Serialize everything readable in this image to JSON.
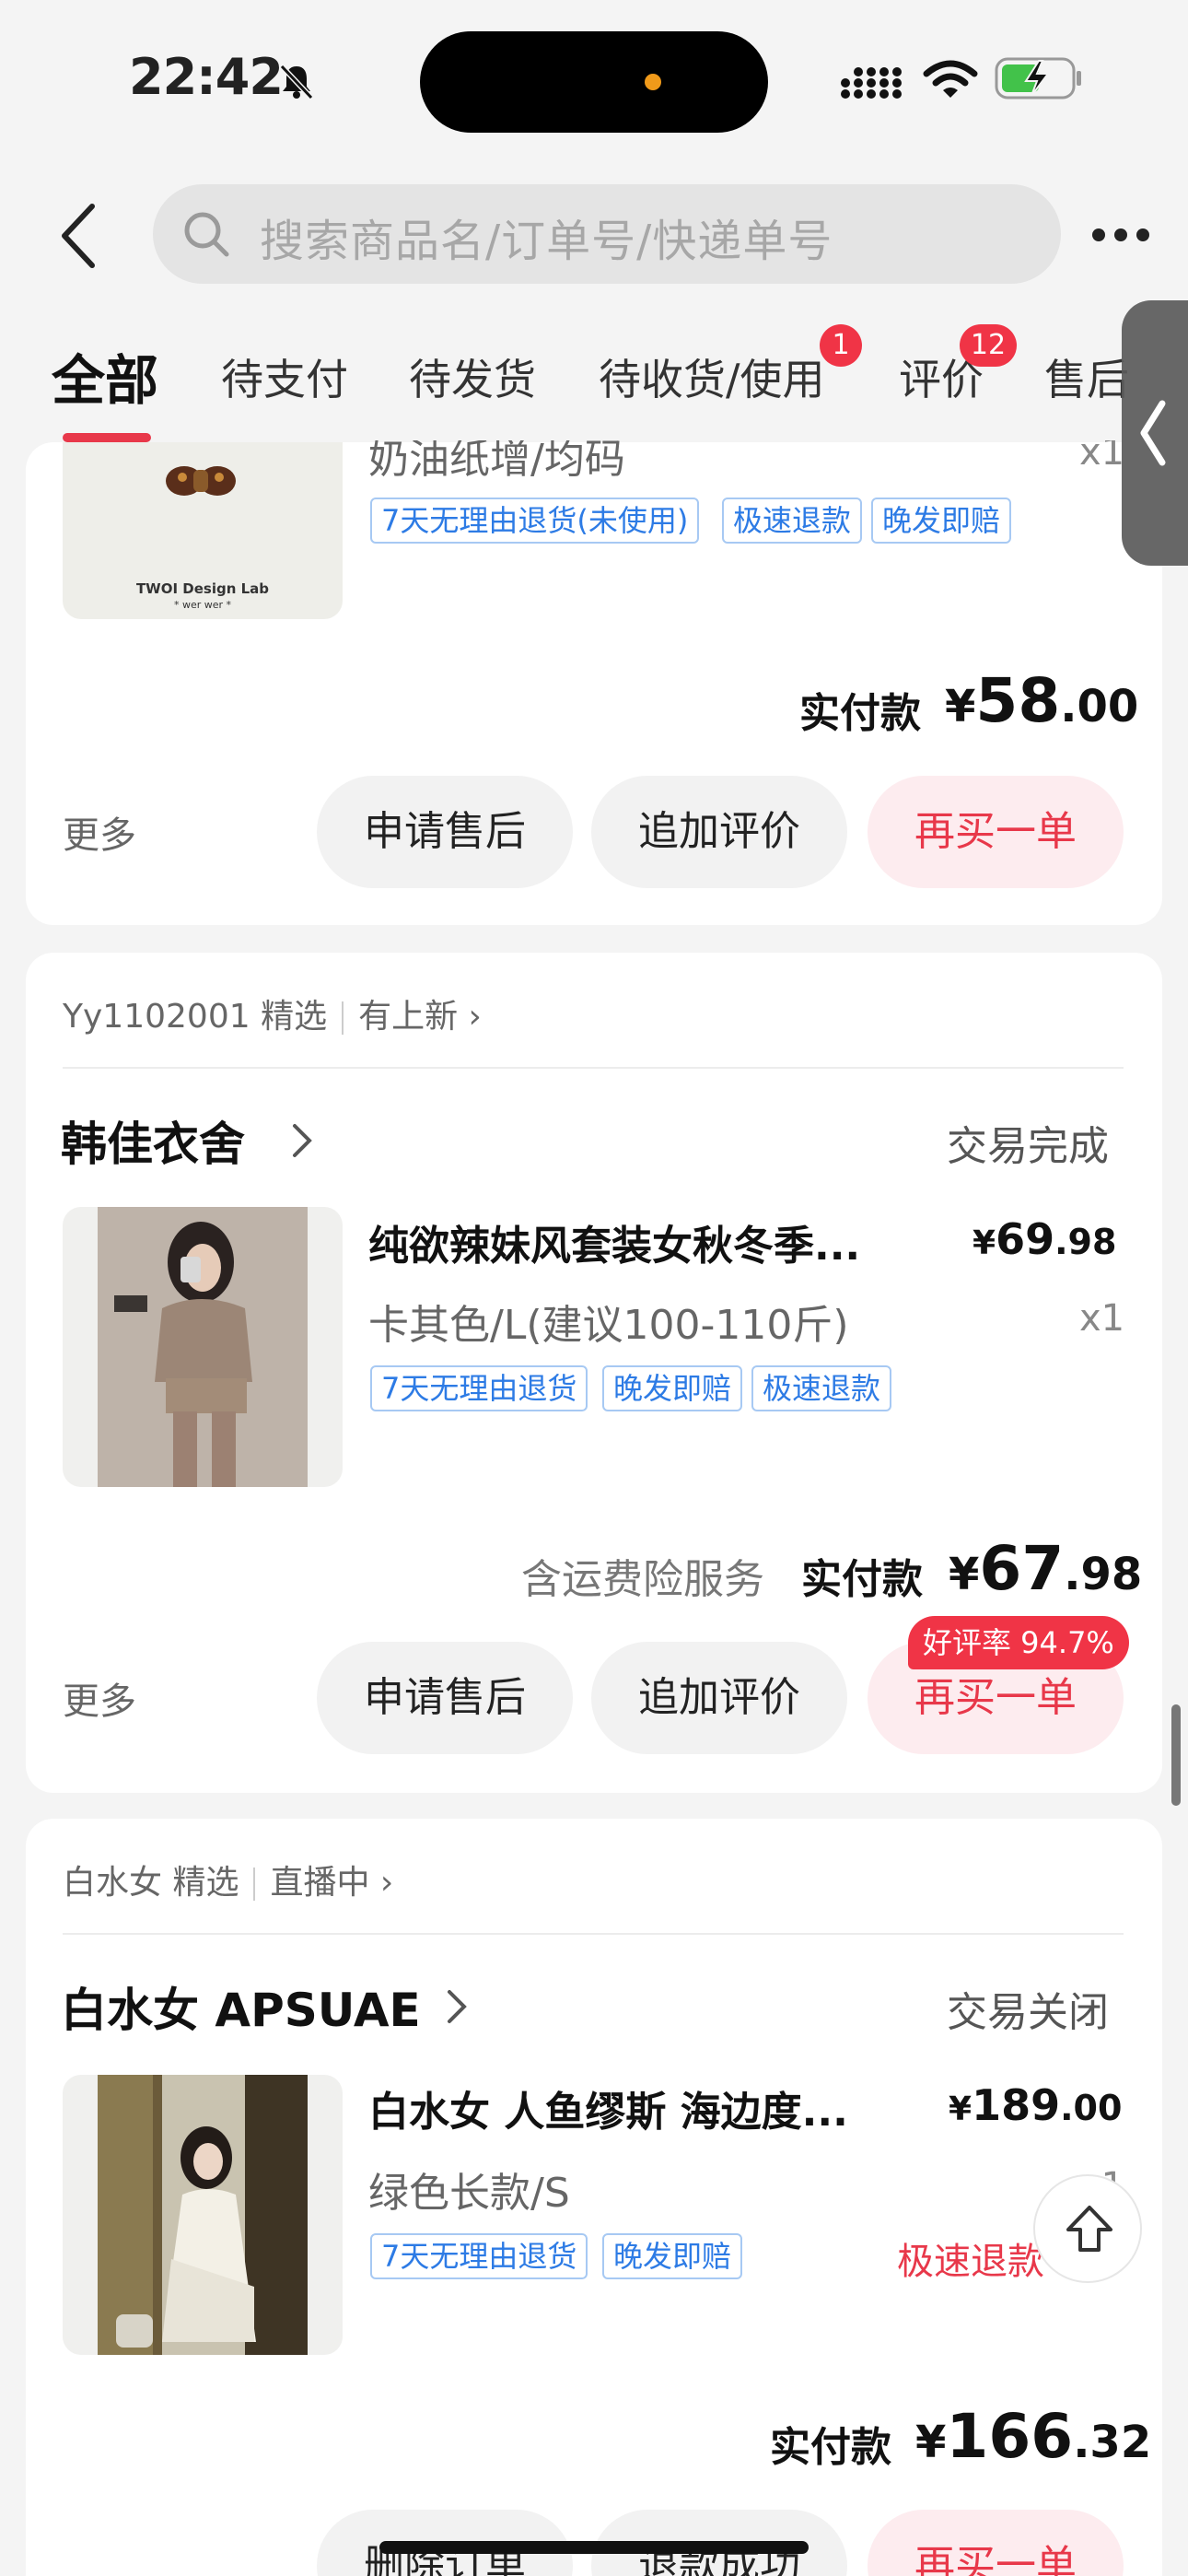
{
  "status_bar": {
    "time": "22:42"
  },
  "search": {
    "placeholder": "搜索商品名/订单号/快递单号"
  },
  "tabs": [
    {
      "label": "全部",
      "active": true
    },
    {
      "label": "待支付"
    },
    {
      "label": "待发货"
    },
    {
      "label": "待收货/使用",
      "badge": "1"
    },
    {
      "label": "评价",
      "badge": "12"
    },
    {
      "label": "售后"
    }
  ],
  "orders": [
    {
      "product": {
        "spec": "奶油纸增/均码",
        "qty": "x1",
        "thumb_brand": "TWOI Design Lab",
        "thumb_sub": "* wer wer *",
        "tags": [
          "7天无理由退货(未使用)",
          "极速退款",
          "晚发即赔"
        ]
      },
      "paid_label": "实付款",
      "paid_currency": "¥",
      "paid_int": "58",
      "paid_dec": ".00",
      "more_label": "更多",
      "buttons": [
        "申请售后",
        "追加评价",
        "再买一单"
      ]
    },
    {
      "shop_bar": {
        "seller": "Yy1102001 精选",
        "link": "有上新"
      },
      "shop_name": "韩佳衣舍",
      "status": "交易完成",
      "product": {
        "title": "纯欲辣妹风套装女秋冬季...",
        "price_currency": "¥",
        "price_int": "69",
        "price_dec": ".98",
        "spec": "卡其色/L(建议100-110斤)",
        "qty": "x1",
        "tags": [
          "7天无理由退货",
          "晚发即赔",
          "极速退款"
        ]
      },
      "service_note": "含运费险服务",
      "paid_label": "实付款",
      "paid_currency": "¥",
      "paid_int": "67",
      "paid_dec": ".98",
      "rating_bubble": "好评率 94.7%",
      "more_label": "更多",
      "buttons": [
        "申请售后",
        "追加评价",
        "再买一单"
      ]
    },
    {
      "shop_bar": {
        "seller": "白水女 精选",
        "link": "直播中"
      },
      "shop_name": "白水女 APSUAE",
      "status": "交易关闭",
      "product": {
        "title": "白水女 人鱼缪斯 海边度...",
        "price_currency": "¥",
        "price_int": "189",
        "price_dec": ".00",
        "spec": "绿色长款/S",
        "qty": "x1",
        "tags": [
          "7天无理由退货",
          "晚发即赔"
        ],
        "refund_note": "极速退款"
      },
      "paid_label": "实付款",
      "paid_currency": "¥",
      "paid_int": "166",
      "paid_dec": ".32",
      "buttons": [
        "删除订单",
        "退款成功",
        "再买一单"
      ]
    }
  ],
  "colors": {
    "accent": "#e8384a",
    "tag_blue": "#2d7be5",
    "bg": "#f4f4f4"
  }
}
